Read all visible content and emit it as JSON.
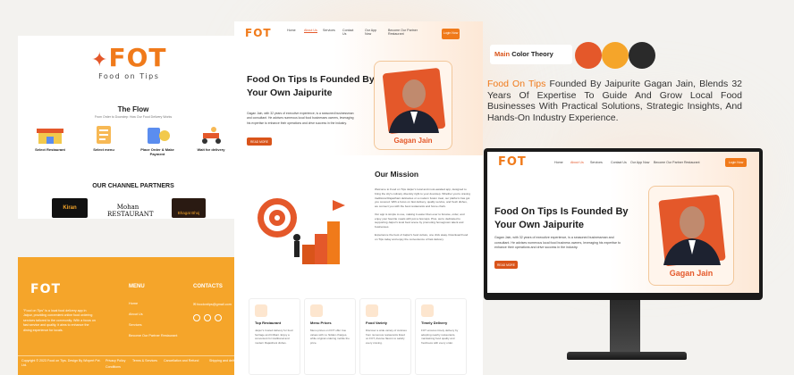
{
  "logo": {
    "word": "FOT",
    "tagline": "Food on Tips"
  },
  "colors": {
    "accent": "#f07a1a",
    "red_orange": "#e4582a",
    "yellow_orange": "#f5a52a",
    "dark": "#2a2a2a"
  },
  "flow": {
    "title": "The Flow",
    "subtitle": "From Order to Doorstep: How Our Food Delivery Works",
    "steps": [
      "Select Restaurant",
      "Select menu",
      "Place Order & Make Payment",
      "Wait for delivery"
    ]
  },
  "partners": {
    "title": "OUR CHANNEL PARTNERS",
    "brands": [
      "Kiran",
      "Mohan RESTAURANT",
      "Bhagat Bhoj"
    ]
  },
  "footer": {
    "about": "\"Food on Tips\" is a local food delivery app in Jaipur, providing convenient online food ordering services tailored to the community. With a focus on fast service and quality, it aims to enhance the dining experience for locals.",
    "menu_title": "MENU",
    "menu": [
      "Home",
      "About Us",
      "Services",
      "Become Our Partner Restaurant"
    ],
    "contacts_title": "CONTACTS",
    "email": "foodontips@gmail.com",
    "copyright": "Copyright © 2023 Food on Tips. Design By Wixpert Pvt. Ltd.",
    "links": [
      "Privacy Policy",
      "Terms & Services",
      "Cancellation and Refund",
      "Shipping and delivery"
    ],
    "conditions": "Conditions"
  },
  "nav": {
    "items": [
      "Home",
      "About Us",
      "Services",
      "Contact Us",
      "Our App Now",
      "Become Our Partner Restaurant"
    ],
    "cta": "Login Now"
  },
  "hero": {
    "title": "Food On Tips Is Founded By Your Own Jaipurite",
    "body": "Gagan Jain, with 32 years of executive experience, is a seasoned businessman and consultant. He advises numerous local food businesses owners, leveraging his expertise to enhance their operations and drive success in the industry.",
    "button": "READ MORE",
    "person": "Gagan Jain"
  },
  "mission": {
    "title": "Our Mission",
    "p1": "Welcome to Food on Tips Jaipur's local and most-awaited app, designed to bring the city's culinary diversity right to your doorstep. Whether you're craving traditional Rajasthani delicacies or a modern fusion treat, our platform has got you covered. With a focus on fast delivery, quality service, and fresh dishes, we connect you with the best restaurants and home chefs.",
    "p2": "Our app is simple to use, making it easier than ever to browse, order, and enjoy your favorite meals with just a few taps. Plus, we're dedicated to supporting Jaipur's local food scene by promoting homegrown talent and businesses.",
    "p3": "Experience the best of Jaipur's food culture, one click away. Download Food on Tips today and enjoy the convenience of fast delivery."
  },
  "features": [
    {
      "title": "Top Restaurant",
      "desc": "Jaipur's trusted delivery for food heritage and brilliant. Enjoy a convenient for traditional and modern Rajasthani dishes."
    },
    {
      "title": "Menu Prices",
      "desc": "Menu prices on FOT offer true values with no hidden charges, while original ordering mobile the price."
    },
    {
      "title": "Food Variety",
      "desc": "Discover a wide variety of cuisines from numerous restaurants listed on FOT, diverse flavors to satisfy every craving."
    },
    {
      "title": "Timely Delivery",
      "desc": "FOT ensures timely delivery by adopting nearby restaurants, maintaining food quality and freshness with every order."
    }
  ],
  "theory": {
    "label_main": "Main",
    "label_rest": "Color Theory",
    "swatches": [
      "#e4582a",
      "#f5a52a",
      "#2a2a2a"
    ]
  },
  "about_text": {
    "lead": "Food On Tips",
    "rest": " Founded By Jaipurite Gagan Jain, Blends 32 Years Of Expertise To Guide And Grow Local Food Businesses With Practical Solutions, Strategic Insights, And Hands-On Industry Experience."
  },
  "monitor": {
    "nav": [
      "Home",
      "About Us",
      "Services",
      "Contact Us",
      "Our App Now",
      "Become Our Partner Restaurant"
    ],
    "cta": "Login Now",
    "title": "Food On Tips Is Founded By Your Own Jaipurite",
    "body": "Gagan Jain, with 32 years of executive experience, is a seasoned businessman and consultant. He advises numerous local food business owners, leveraging his expertise to enhance their operations and drive success in the industry.",
    "button": "READ MORE",
    "person": "Gagan Jain"
  }
}
